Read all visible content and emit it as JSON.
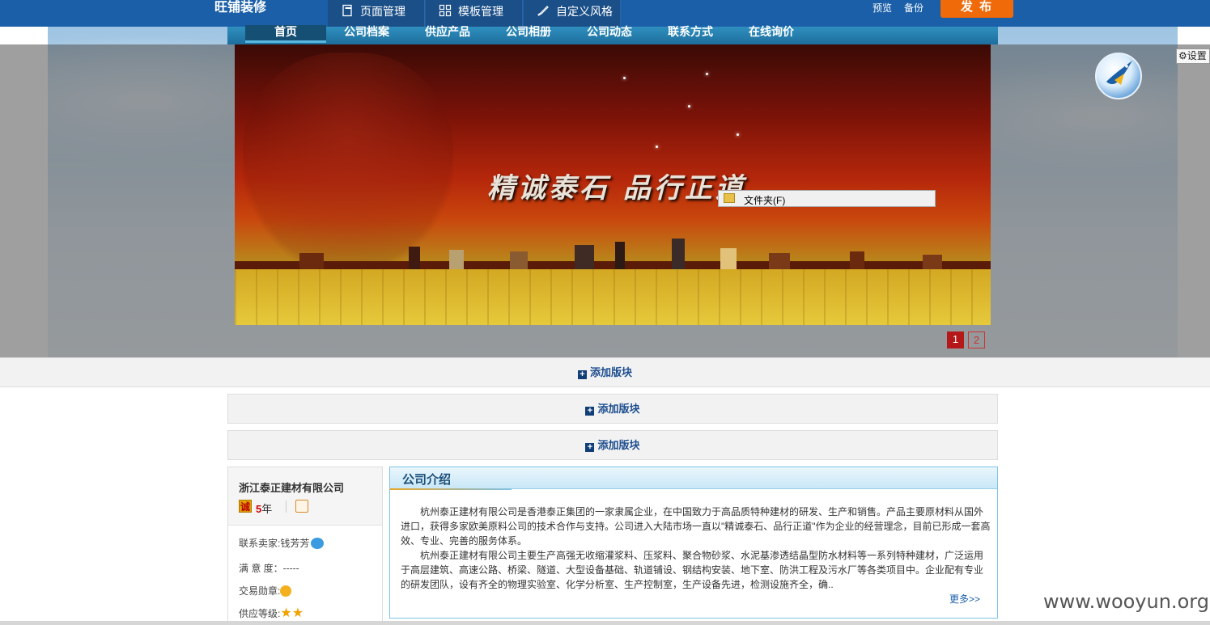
{
  "toolbar": {
    "brand": "旺铺装修",
    "page_manage": "页面管理",
    "template_manage": "模板管理",
    "custom_style": "自定义风格",
    "preview": "预览",
    "backup": "备份",
    "publish": "发 布"
  },
  "nav": {
    "items": [
      "首页",
      "公司档案",
      "供应产品",
      "公司相册",
      "公司动态",
      "联系方式",
      "在线询价"
    ]
  },
  "banner": {
    "slogan": "精诚泰石  品行正道",
    "pages": [
      "1",
      "2"
    ],
    "current_page": 1
  },
  "context_menu": {
    "item": "文件夹(F)"
  },
  "settings": "设置",
  "add_block_label": "添加版块",
  "company_panel": {
    "name": "浙江泰正建材有限公司",
    "cheng_badge": "诚",
    "years_number": "5",
    "years_unit": "年",
    "contact_label": "联系卖家:",
    "contact_name": "钱芳芳",
    "satisfaction_label": "满 意 度：",
    "satisfaction_value": "-----",
    "medal_label": "交易勋章:",
    "level_label": "供应等级:"
  },
  "intro": {
    "title": "公司介绍",
    "para1": "杭州泰正建材有限公司是香港泰正集团的一家隶属企业，在中国致力于高品质特种建材的研发、生产和销售。产品主要原材料从国外进口，获得多家欧美原料公司的技术合作与支持。公司进入大陆市场一直以\"精诚泰石、品行正道\"作为企业的经营理念，目前已形成一套高效、专业、完善的服务体系。",
    "para2": "杭州泰正建材有限公司主要生产高强无收缩灌浆料、压浆料、聚合物砂浆、水泥基渗透结晶型防水材料等一系列特种建材，广泛运用于高层建筑、高速公路、桥梁、隧道、大型设备基础、轨道铺设、钢结构安装、地下室、防洪工程及污水厂等各类项目中。企业配有专业的研发团队，设有齐全的物理实验室、化学分析室、生产控制室，生产设备先进，检测设施齐全，确..",
    "more": "更多>>"
  },
  "watermark": "www.wooyun.org",
  "icons": {
    "page": "page-icon",
    "grid": "grid-icon",
    "brush": "brush-icon",
    "gear": "gear-icon",
    "plus": "plus-icon",
    "folder": "folder-icon",
    "logo": "bird-logo-icon"
  },
  "colors": {
    "topbar": "#1a5fa8",
    "publish": "#f06a0a",
    "nav": "#2f8fbf",
    "pager_active": "#b51818",
    "link": "#1a5fa8"
  }
}
